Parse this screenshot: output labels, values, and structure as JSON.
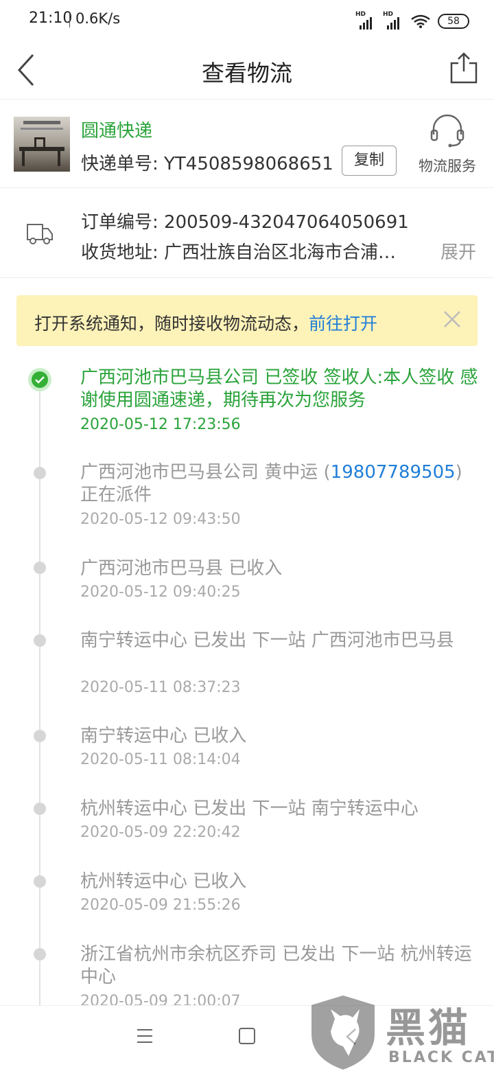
{
  "status_bar": {
    "time": "21:10",
    "speed": "0.6K/s",
    "battery": "58",
    "signal_label": "HD"
  },
  "header": {
    "title": "查看物流"
  },
  "courier": {
    "name": "圆通快递",
    "tracking_label": "快递单号: YT4508598068651",
    "copy_label": "复制",
    "service_label": "物流服务"
  },
  "order": {
    "order_no": "订单编号: 200509-432047064050691",
    "address": "收货地址: 广西壮族自治区北海市合浦…",
    "expand_label": "展开"
  },
  "notice": {
    "text": "打开系统通知，随时接收物流动态，",
    "link": "前往打开"
  },
  "timeline": [
    {
      "text": "广西河池市巴马县公司 已签收  签收人:本人签收 感谢使用圆通速递，期待再次为您服务",
      "time": "2020-05-12 17:23:56"
    },
    {
      "text_before": "广西河池市巴马县公司 黄中运 (",
      "phone": "19807789505",
      "text_after": ") 正在派件",
      "time": "2020-05-12 09:43:50"
    },
    {
      "text": "广西河池市巴马县 已收入",
      "time": "2020-05-12 09:40:25"
    },
    {
      "text": "南宁转运中心 已发出 下一站  广西河池市巴马县",
      "time": "2020-05-11 08:37:23"
    },
    {
      "text": "南宁转运中心 已收入",
      "time": "2020-05-11 08:14:04"
    },
    {
      "text": "杭州转运中心 已发出 下一站  南宁转运中心",
      "time": "2020-05-09 22:20:42"
    },
    {
      "text": "杭州转运中心 已收入",
      "time": "2020-05-09 21:55:26"
    },
    {
      "text": "浙江省杭州市余杭区乔司 已发出 下一站 杭州转运中心",
      "time": "2020-05-09 21:00:07"
    }
  ],
  "watermark": {
    "cn": "黑猫",
    "en": "BLACK CAT"
  },
  "colors": {
    "accent_green": "#2aa33a",
    "link_blue": "#1f7ed8",
    "notice_bg": "#fdf2b8"
  }
}
